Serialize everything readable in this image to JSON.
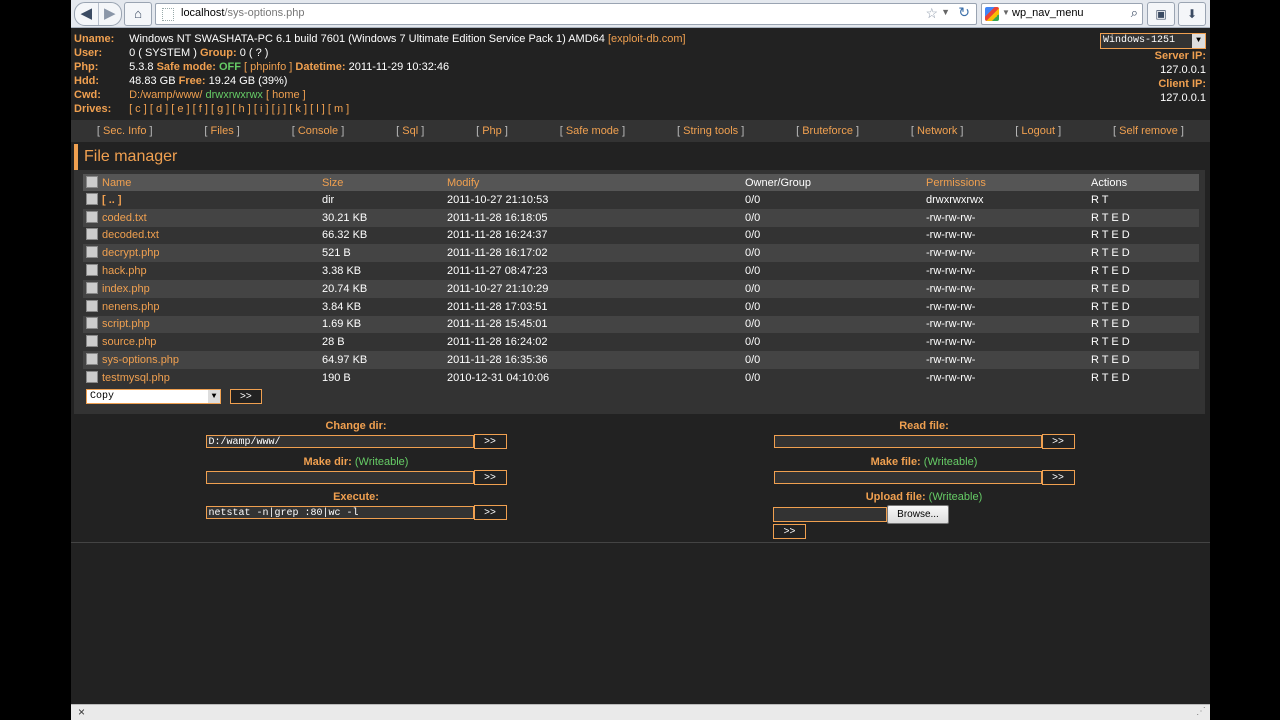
{
  "browser": {
    "url_host": "localhost",
    "url_path": "/sys-options.php",
    "search_engine": "google-icon",
    "search_text": "wp_nav_menu"
  },
  "info": {
    "uname_label": "Uname:",
    "uname_value": "Windows NT SWASHATA-PC 6.1 build 7601 (Windows 7 Ultimate Edition Service Pack 1) AMD64",
    "uname_link": "[exploit-db.com]",
    "user_label": "User:",
    "user_value": "0 ( SYSTEM )",
    "group_label": "Group:",
    "group_value": "0 ( ? )",
    "php_label": "Php:",
    "php_version": "5.3.8",
    "safe_mode_label": "Safe mode:",
    "safe_mode_value": "OFF",
    "phpinfo_link": "[ phpinfo ]",
    "datetime_label": "Datetime:",
    "datetime_value": "2011-11-29 10:32:46",
    "hdd_label": "Hdd:",
    "hdd_value": "48.83 GB",
    "free_label": "Free:",
    "free_value": "19.24 GB (39%)",
    "cwd_label": "Cwd:",
    "cwd_value": "D:/wamp/www/",
    "cwd_perm": "drwxrwxrwx",
    "home_link": "[ home ]",
    "drives_label": "Drives:",
    "drives": [
      "c",
      "d",
      "e",
      "f",
      "g",
      "h",
      "i",
      "j",
      "k",
      "l",
      "m"
    ]
  },
  "right": {
    "charset": "Windows-1251",
    "server_ip_label": "Server IP:",
    "server_ip": "127.0.0.1",
    "client_ip_label": "Client IP:",
    "client_ip": "127.0.0.1"
  },
  "menu": [
    "Sec. Info",
    "Files",
    "Console",
    "Sql",
    "Php",
    "Safe mode",
    "String tools",
    "Bruteforce",
    "Network",
    "Logout",
    "Self remove"
  ],
  "file_manager": {
    "title": "File manager",
    "columns": [
      "Name",
      "Size",
      "Modify",
      "Owner/Group",
      "Permissions",
      "Actions"
    ],
    "rows": [
      {
        "name": "[ .. ]",
        "size": "dir",
        "modify": "2011-10-27 21:10:53",
        "owner": "0/0",
        "perms": "drwxrwxrwx",
        "actions": "R T"
      },
      {
        "name": "coded.txt",
        "size": "30.21 KB",
        "modify": "2011-11-28 16:18:05",
        "owner": "0/0",
        "perms": "-rw-rw-rw-",
        "actions": "R T E D"
      },
      {
        "name": "decoded.txt",
        "size": "66.32 KB",
        "modify": "2011-11-28 16:24:37",
        "owner": "0/0",
        "perms": "-rw-rw-rw-",
        "actions": "R T E D"
      },
      {
        "name": "decrypt.php",
        "size": "521 B",
        "modify": "2011-11-28 16:17:02",
        "owner": "0/0",
        "perms": "-rw-rw-rw-",
        "actions": "R T E D"
      },
      {
        "name": "hack.php",
        "size": "3.38 KB",
        "modify": "2011-11-27 08:47:23",
        "owner": "0/0",
        "perms": "-rw-rw-rw-",
        "actions": "R T E D"
      },
      {
        "name": "index.php",
        "size": "20.74 KB",
        "modify": "2011-10-27 21:10:29",
        "owner": "0/0",
        "perms": "-rw-rw-rw-",
        "actions": "R T E D"
      },
      {
        "name": "nenens.php",
        "size": "3.84 KB",
        "modify": "2011-11-28 17:03:51",
        "owner": "0/0",
        "perms": "-rw-rw-rw-",
        "actions": "R T E D"
      },
      {
        "name": "script.php",
        "size": "1.69 KB",
        "modify": "2011-11-28 15:45:01",
        "owner": "0/0",
        "perms": "-rw-rw-rw-",
        "actions": "R T E D"
      },
      {
        "name": "source.php",
        "size": "28 B",
        "modify": "2011-11-28 16:24:02",
        "owner": "0/0",
        "perms": "-rw-rw-rw-",
        "actions": "R T E D"
      },
      {
        "name": "sys-options.php",
        "size": "64.97 KB",
        "modify": "2011-11-28 16:35:36",
        "owner": "0/0",
        "perms": "-rw-rw-rw-",
        "actions": "R T E D"
      },
      {
        "name": "testmysql.php",
        "size": "190 B",
        "modify": "2010-12-31 04:10:06",
        "owner": "0/0",
        "perms": "-rw-rw-rw-",
        "actions": "R T E D"
      }
    ],
    "bulk_action": "Copy",
    "go_label": ">>"
  },
  "forms": {
    "change_dir_label": "Change dir:",
    "change_dir_value": "D:/wamp/www/",
    "make_dir_label": "Make dir:",
    "make_dir_note": "(Writeable)",
    "execute_label": "Execute:",
    "execute_value": "netstat -n|grep :80|wc -l",
    "read_file_label": "Read file:",
    "make_file_label": "Make file:",
    "make_file_note": "(Writeable)",
    "upload_file_label": "Upload file:",
    "upload_file_note": "(Writeable)",
    "browse_label": "Browse...",
    "go_label": ">>"
  }
}
